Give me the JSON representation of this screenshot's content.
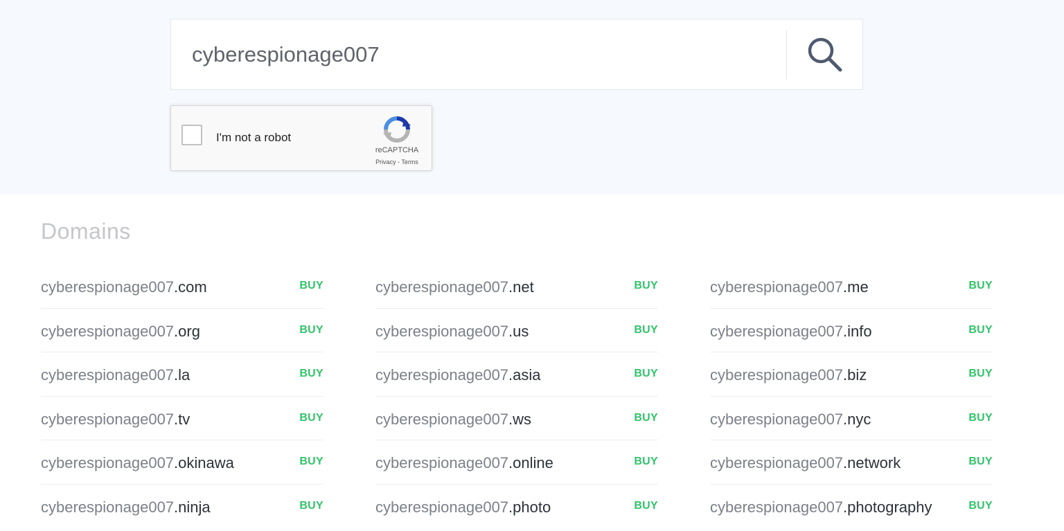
{
  "search": {
    "value": "cyberespionage007",
    "icon": "search-icon"
  },
  "captcha": {
    "label": "I'm not a robot",
    "brand": "reCAPTCHA",
    "privacy_label": "Privacy",
    "separator": " - ",
    "terms_label": "Terms",
    "icon": "recaptcha-logo-icon"
  },
  "domains": {
    "heading": "Domains",
    "buy_label": "BUY",
    "accent_color": "#31c46a",
    "columns": [
      [
        {
          "base": "cyberespionage007",
          "tld": ".com"
        },
        {
          "base": "cyberespionage007",
          "tld": ".org"
        },
        {
          "base": "cyberespionage007",
          "tld": ".la"
        },
        {
          "base": "cyberespionage007",
          "tld": ".tv"
        },
        {
          "base": "cyberespionage007",
          "tld": ".okinawa"
        },
        {
          "base": "cyberespionage007",
          "tld": ".ninja"
        }
      ],
      [
        {
          "base": "cyberespionage007",
          "tld": ".net"
        },
        {
          "base": "cyberespionage007",
          "tld": ".us"
        },
        {
          "base": "cyberespionage007",
          "tld": ".asia"
        },
        {
          "base": "cyberespionage007",
          "tld": ".ws"
        },
        {
          "base": "cyberespionage007",
          "tld": ".online"
        },
        {
          "base": "cyberespionage007",
          "tld": ".photo"
        }
      ],
      [
        {
          "base": "cyberespionage007",
          "tld": ".me"
        },
        {
          "base": "cyberespionage007",
          "tld": ".info"
        },
        {
          "base": "cyberespionage007",
          "tld": ".biz"
        },
        {
          "base": "cyberespionage007",
          "tld": ".nyc"
        },
        {
          "base": "cyberespionage007",
          "tld": ".network"
        },
        {
          "base": "cyberespionage007",
          "tld": ".photography"
        }
      ]
    ]
  }
}
